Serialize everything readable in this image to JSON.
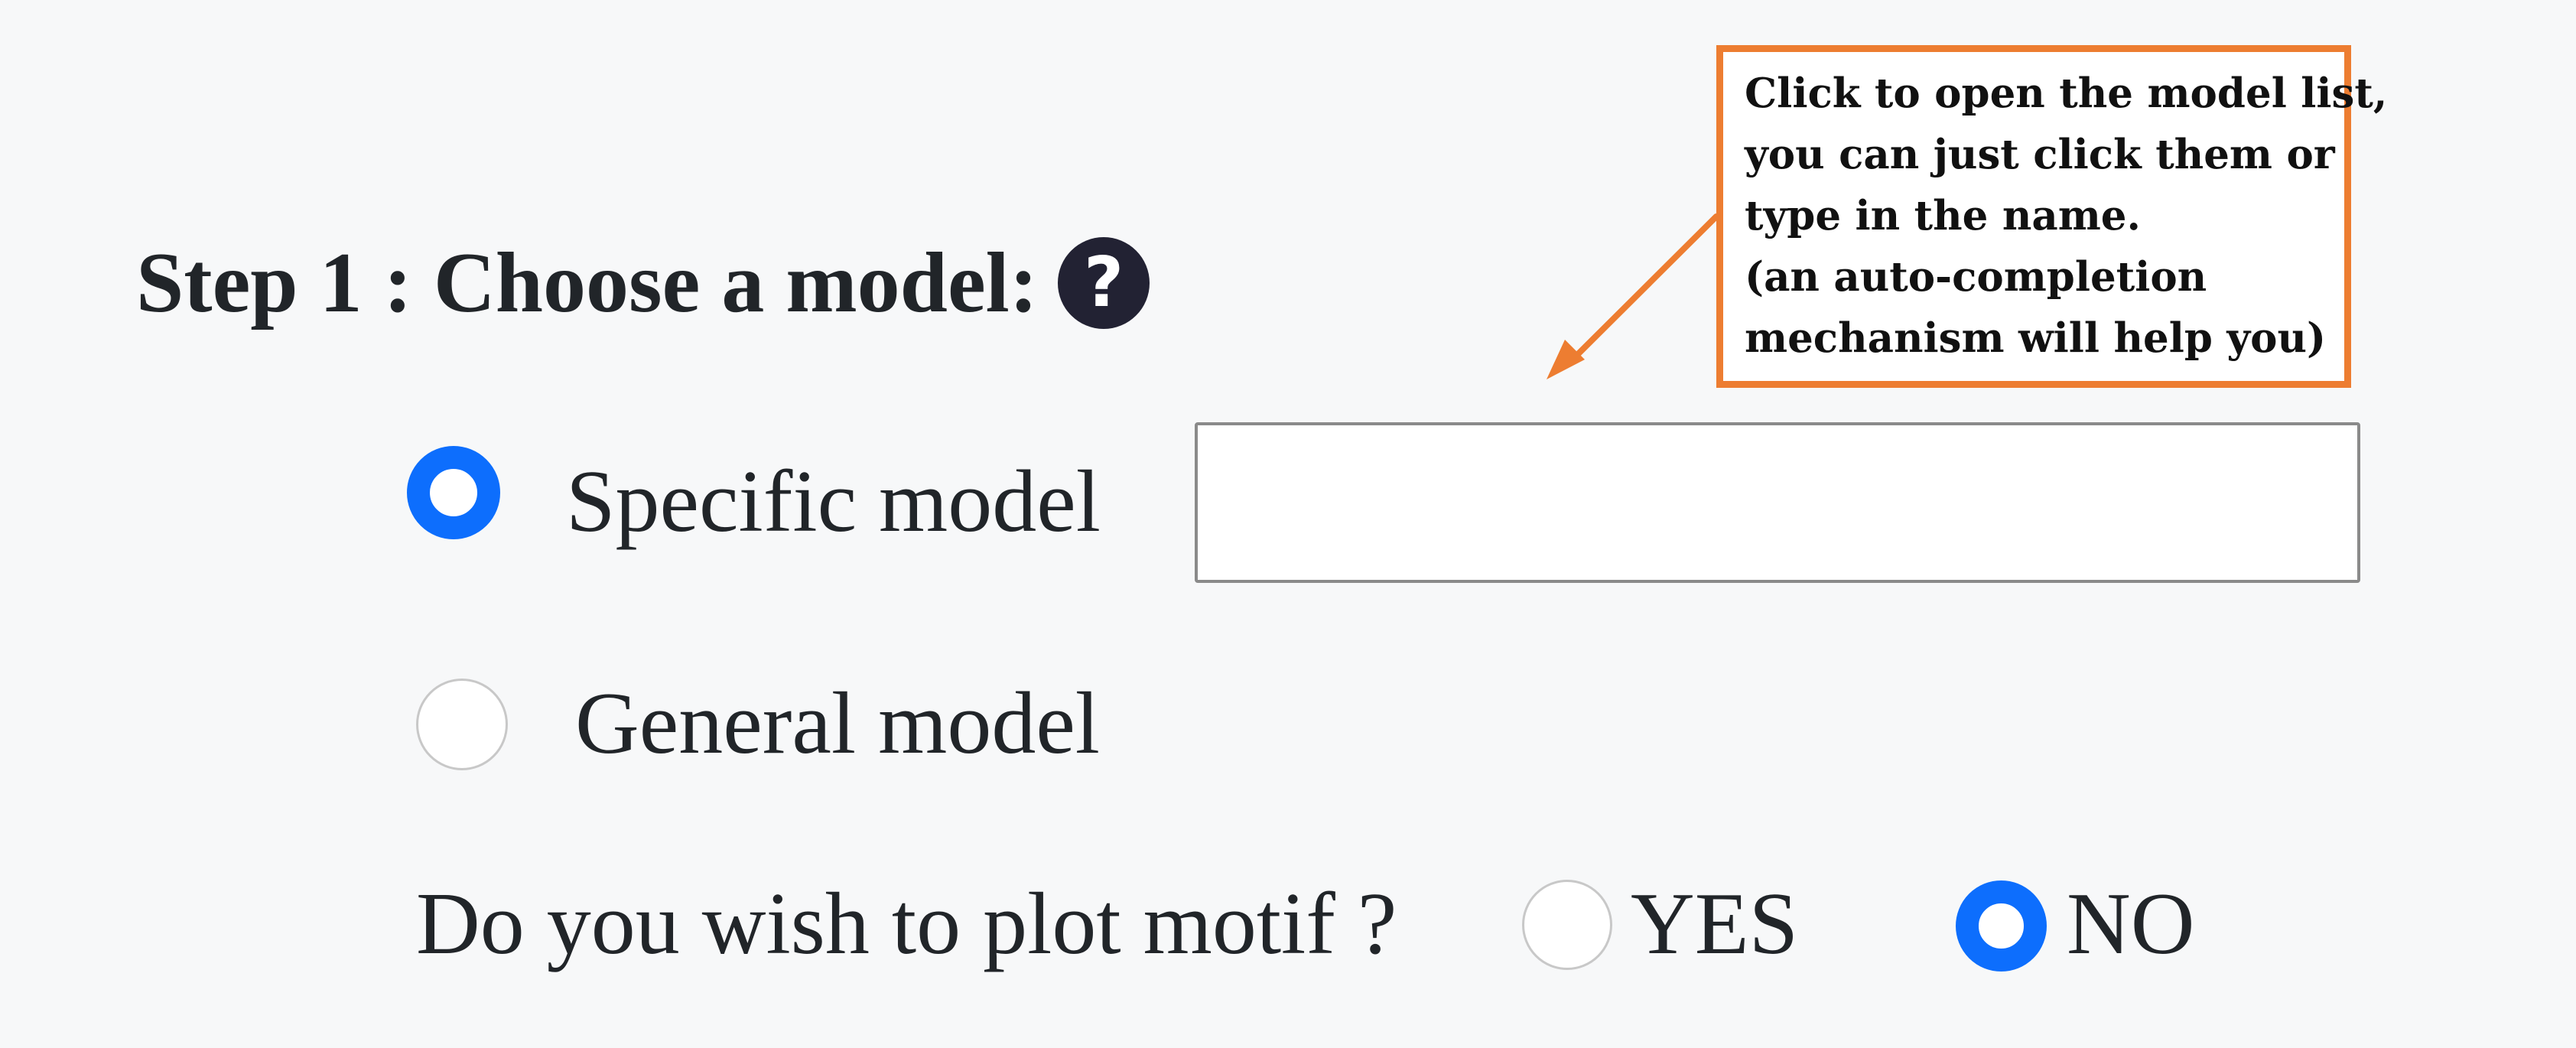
{
  "step": {
    "title": "Step 1 : Choose a model:",
    "help_icon": "question-circle-icon",
    "help_glyph": "?"
  },
  "model_choice": {
    "options": [
      {
        "label": "Specific model",
        "checked": true
      },
      {
        "label": "General model",
        "checked": false
      }
    ],
    "specific_model_input": {
      "value": "",
      "placeholder": ""
    }
  },
  "plot_motif": {
    "question": "Do you wish to plot motif ?",
    "options": [
      {
        "label": "YES",
        "checked": false
      },
      {
        "label": "NO",
        "checked": true
      }
    ]
  },
  "annotation": {
    "lines": [
      "Click to open the model list,",
      "you can just click them or",
      "type in the name.",
      "(an auto-completion",
      "mechanism will help you)"
    ]
  },
  "colors": {
    "accent": "#0d6efd",
    "callout_border": "#ed7d31",
    "background": "#f7f8f9"
  }
}
